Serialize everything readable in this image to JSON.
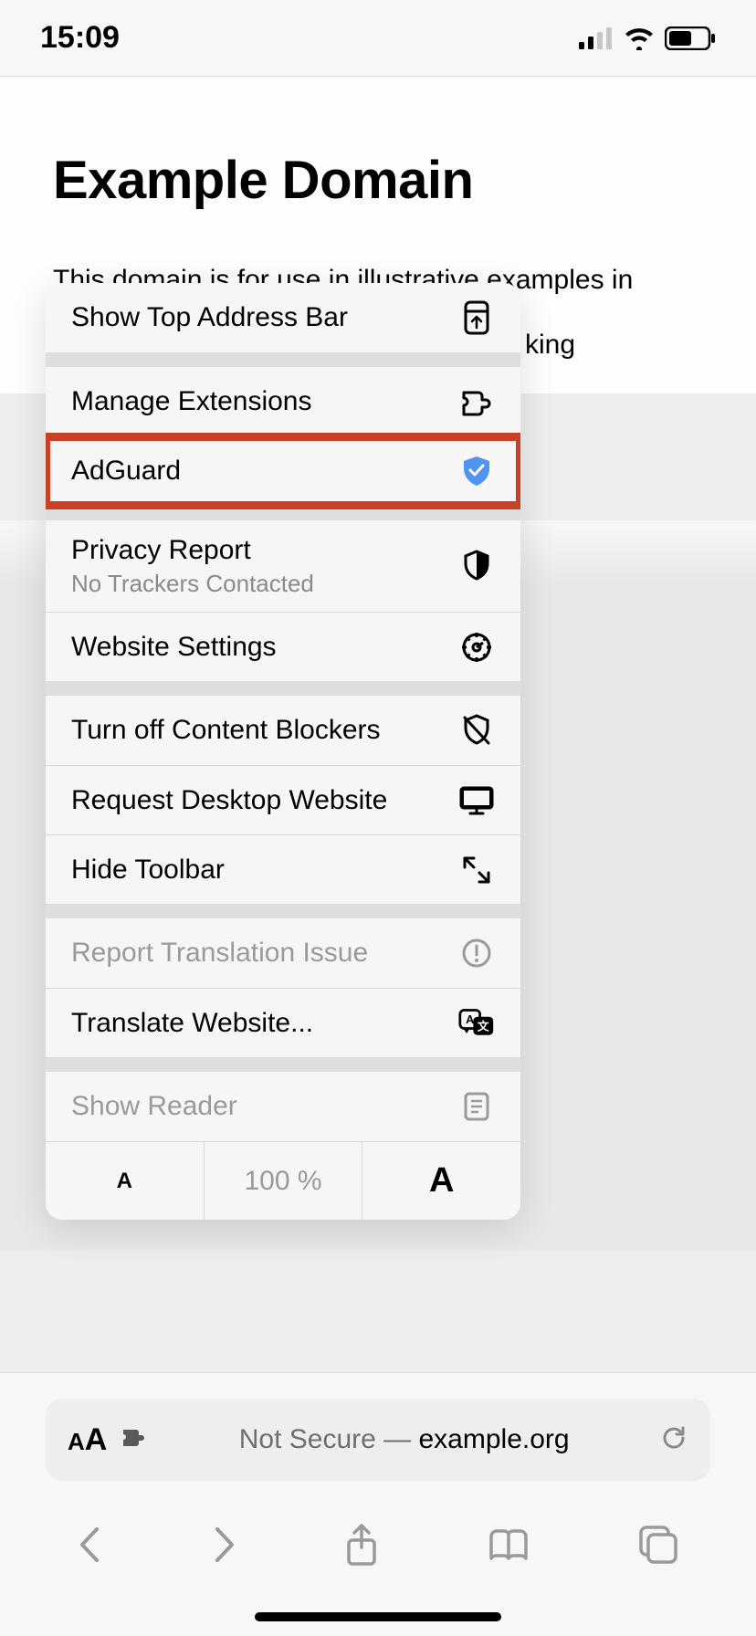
{
  "status": {
    "time": "15:09"
  },
  "page": {
    "title": "Example Domain",
    "body_visible": "This domain is for use in illustrative examples in",
    "body_tail": "king"
  },
  "menu": {
    "show_top": "Show Top Address Bar",
    "manage_ext": "Manage Extensions",
    "adguard": "AdGuard",
    "privacy": "Privacy Report",
    "privacy_sub": "No Trackers Contacted",
    "website_settings": "Website Settings",
    "blockers": "Turn off Content Blockers",
    "desktop": "Request Desktop Website",
    "hide_toolbar": "Hide Toolbar",
    "report_trans": "Report Translation Issue",
    "translate": "Translate Website...",
    "show_reader": "Show Reader",
    "zoom_pct": "100 %",
    "zoom_small": "A",
    "zoom_large": "A"
  },
  "urlbar": {
    "aa_small": "A",
    "aa_large": "A",
    "not_secure": "Not Secure — ",
    "domain": "example.org"
  }
}
